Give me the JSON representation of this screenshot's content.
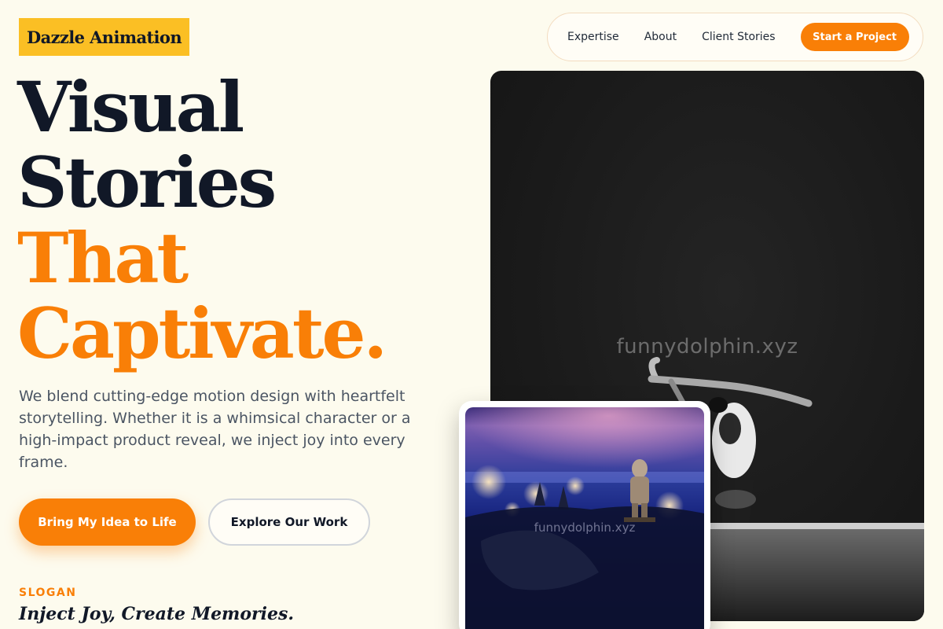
{
  "brand": {
    "name": "Dazzle Animation"
  },
  "nav": {
    "links": [
      "Expertise",
      "About",
      "Client Stories"
    ],
    "cta": "Start a Project"
  },
  "hero": {
    "title_lines_dark": [
      "Visual",
      "Stories"
    ],
    "title_lines_accent": [
      "That",
      "Captivate."
    ],
    "description": "We blend cutting-edge motion design with heartfelt storytelling. Whether it is a whimsical character or a high-impact product reveal, we inject joy into every frame.",
    "primary_button": "Bring My Idea to Life",
    "secondary_button": "Explore Our Work"
  },
  "slogan": {
    "label": "SLOGAN",
    "text": "Inject Joy, Create Memories."
  },
  "images": {
    "main_watermark": "funnydolphin.xyz",
    "card_watermark": "funnydolphin.xyz"
  },
  "colors": {
    "accent": "#f97f07",
    "logo_bg": "#fbbf24",
    "background": "#fdfbee",
    "heading": "#111827"
  }
}
